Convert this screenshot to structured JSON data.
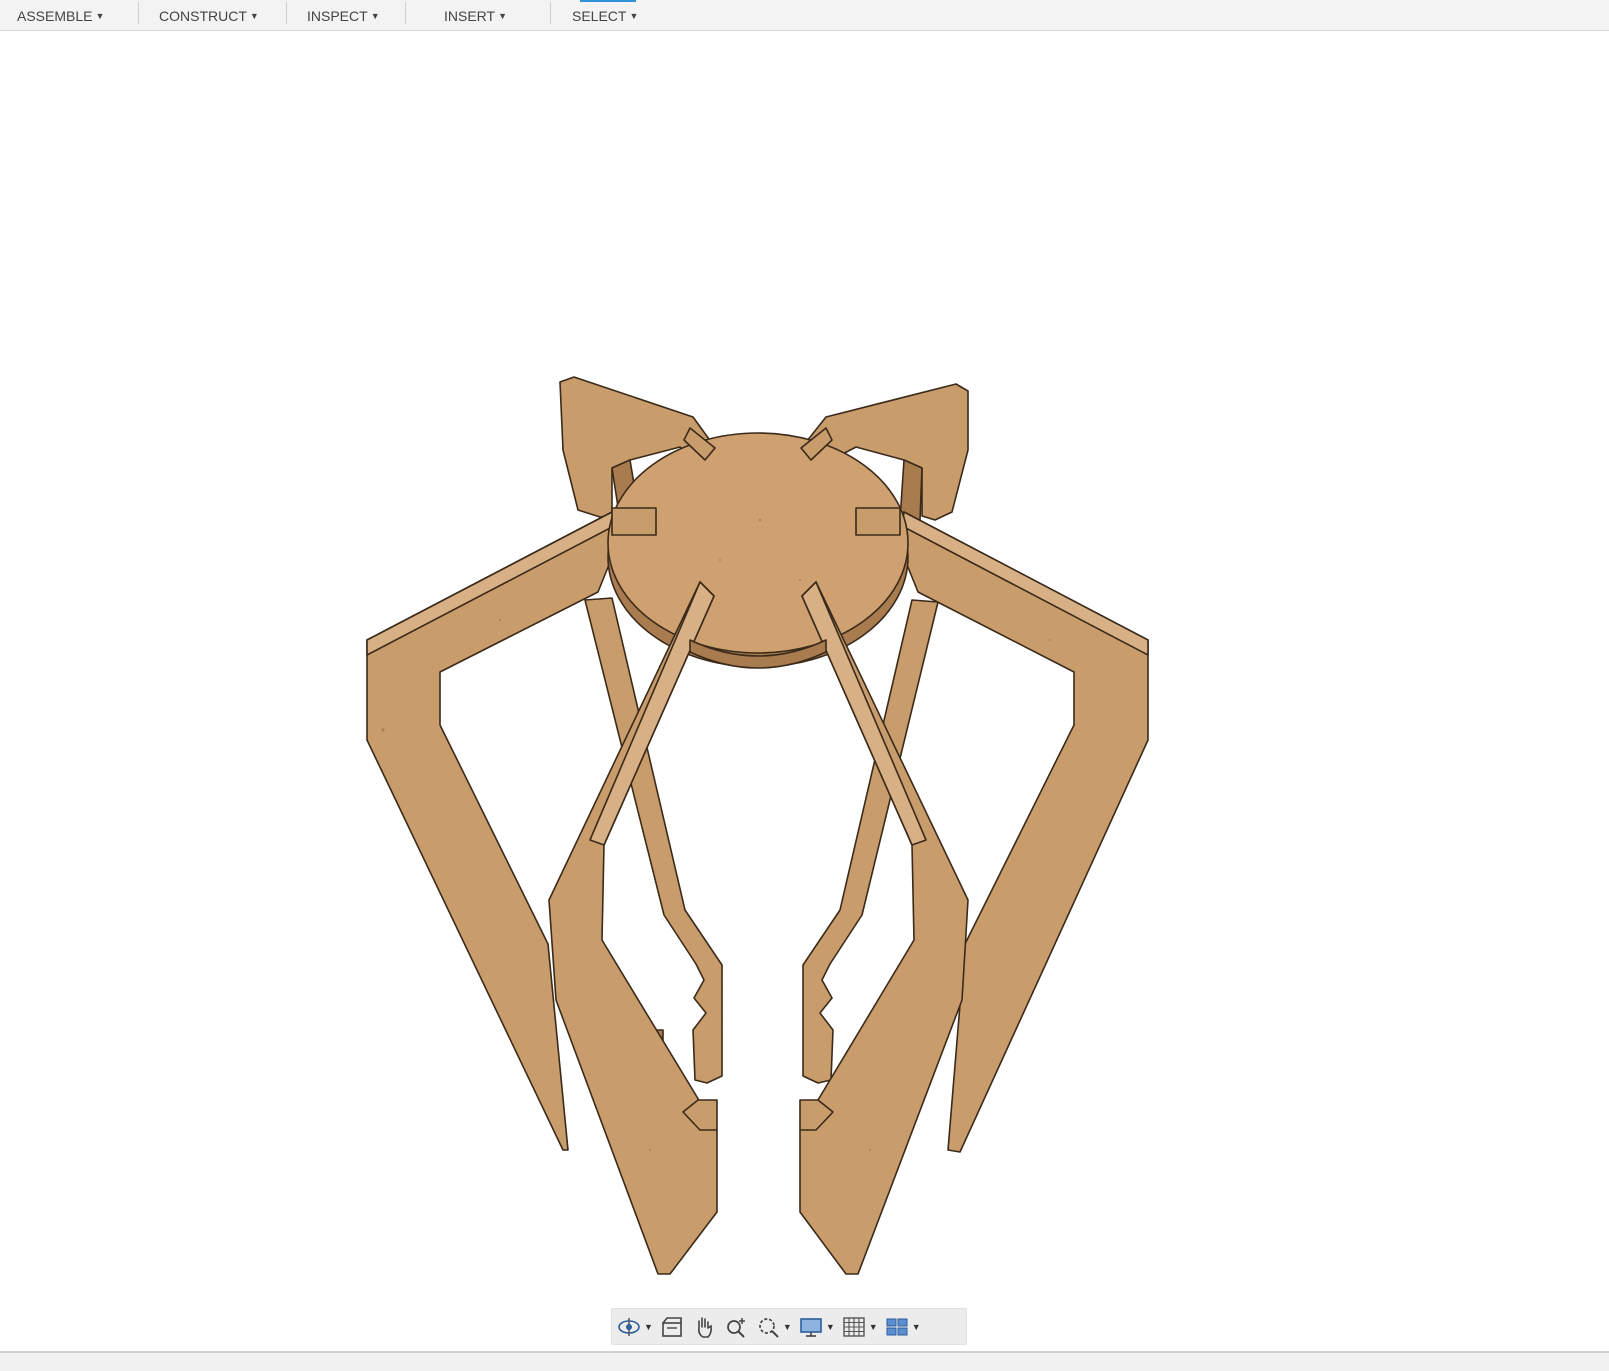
{
  "toolbar": {
    "menus": [
      "ASSEMBLE",
      "CONSTRUCT",
      "INSPECT",
      "INSERT",
      "SELECT"
    ]
  },
  "model": {
    "colors": {
      "wood": "#c99c6c",
      "wood_dark": "#a97c4f",
      "wood_light": "#d8b086",
      "outline": "#3a2a1a"
    }
  },
  "nav_bar": {
    "tools": [
      "orbit-icon",
      "look-at-icon",
      "pan-icon",
      "zoom-icon",
      "fit-icon",
      "display-settings-icon",
      "grid-icon",
      "viewports-icon"
    ]
  }
}
